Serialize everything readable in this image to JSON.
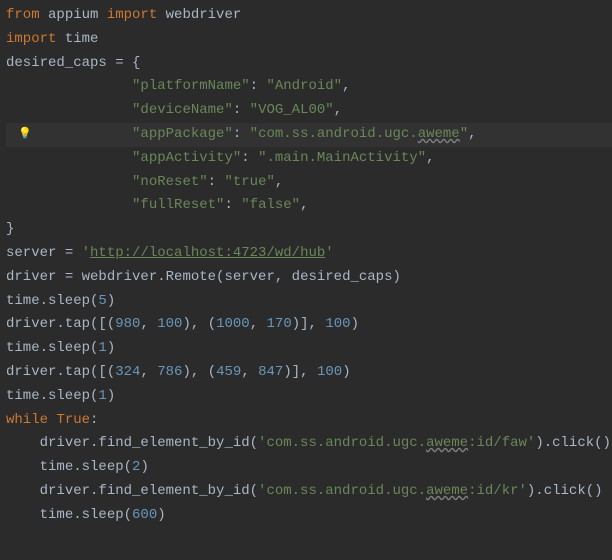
{
  "lines": {
    "l1": {
      "kw1": "from",
      "id1": " appium ",
      "kw2": "import",
      "id2": " webdriver"
    },
    "l2": {
      "kw1": "import",
      "id1": " time"
    },
    "l3": {
      "id1": "desired_caps ",
      "punct1": "=",
      "punct2": " {"
    },
    "l4": {
      "pad": "               ",
      "s1": "\"platformName\"",
      "c": ": ",
      "s2": "\"Android\"",
      "e": ","
    },
    "l5": {
      "pad": "               ",
      "s1": "\"deviceName\"",
      "c": ": ",
      "s2": "\"VOG_AL00\"",
      "e": ","
    },
    "l6": {
      "pad": "               ",
      "s1": "\"appPackage\"",
      "c": ": ",
      "s2a": "\"com.ss.android.ugc.",
      "s2b": "aweme",
      "s2c": "\"",
      "e": ","
    },
    "l7": {
      "pad": "               ",
      "s1": "\"appActivity\"",
      "c": ": ",
      "s2": "\".main.MainActivity\"",
      "e": ","
    },
    "l8": {
      "pad": "               ",
      "s1": "\"noReset\"",
      "c": ": ",
      "s2": "\"true\"",
      "e": ","
    },
    "l9": {
      "pad": "               ",
      "s1": "\"fullReset\"",
      "c": ": ",
      "s2": "\"false\"",
      "e": ","
    },
    "l10": {
      "t": "}"
    },
    "l11": {
      "id1": "server ",
      "eq": "= ",
      "q1": "'",
      "url": "http://localhost:4723/wd/hub",
      "q2": "'"
    },
    "l12": {
      "id1": "driver ",
      "eq": "= ",
      "id2": "webdriver.Remote(server",
      "c": ", ",
      "id3": "desired_caps)"
    },
    "l13": {
      "id1": "time.sleep(",
      "n": "5",
      "p": ")"
    },
    "l14": {
      "id1": "driver.tap([(",
      "n1": "980",
      "c1": ", ",
      "n2": "100",
      "p1": ")",
      "c2": ", ",
      "p2": "(",
      "n3": "1000",
      "c3": ", ",
      "n4": "170",
      "p3": ")]",
      "c4": ", ",
      "n5": "100",
      "p4": ")"
    },
    "l15": {
      "id1": "time.sleep(",
      "n": "1",
      "p": ")"
    },
    "l16": {
      "id1": "driver.tap([(",
      "n1": "324",
      "c1": ", ",
      "n2": "786",
      "p1": ")",
      "c2": ", ",
      "p2": "(",
      "n3": "459",
      "c3": ", ",
      "n4": "847",
      "p3": ")]",
      "c4": ", ",
      "n5": "100",
      "p4": ")"
    },
    "l17": {
      "id1": "time.sleep(",
      "n": "1",
      "p": ")"
    },
    "l18": {
      "kw": "while ",
      "b": "True",
      "c": ":"
    },
    "l19": {
      "pad": "    ",
      "id1": "driver.find_element_by_id(",
      "s1": "'com.ss.android.ugc.",
      "s2": "aweme",
      "s3": ":id/faw'",
      "p": ").click()"
    },
    "l20": {
      "pad": "    ",
      "id1": "time.sleep(",
      "n": "2",
      "p": ")"
    },
    "l21": {
      "pad": "    ",
      "id1": "driver.find_element_by_id(",
      "s1": "'com.ss.android.ugc.",
      "s2": "aweme",
      "s3": ":id/kr'",
      "p": ").click()"
    },
    "l22": {
      "pad": "    ",
      "id1": "time.sleep(",
      "n": "600",
      "p": ")"
    }
  }
}
